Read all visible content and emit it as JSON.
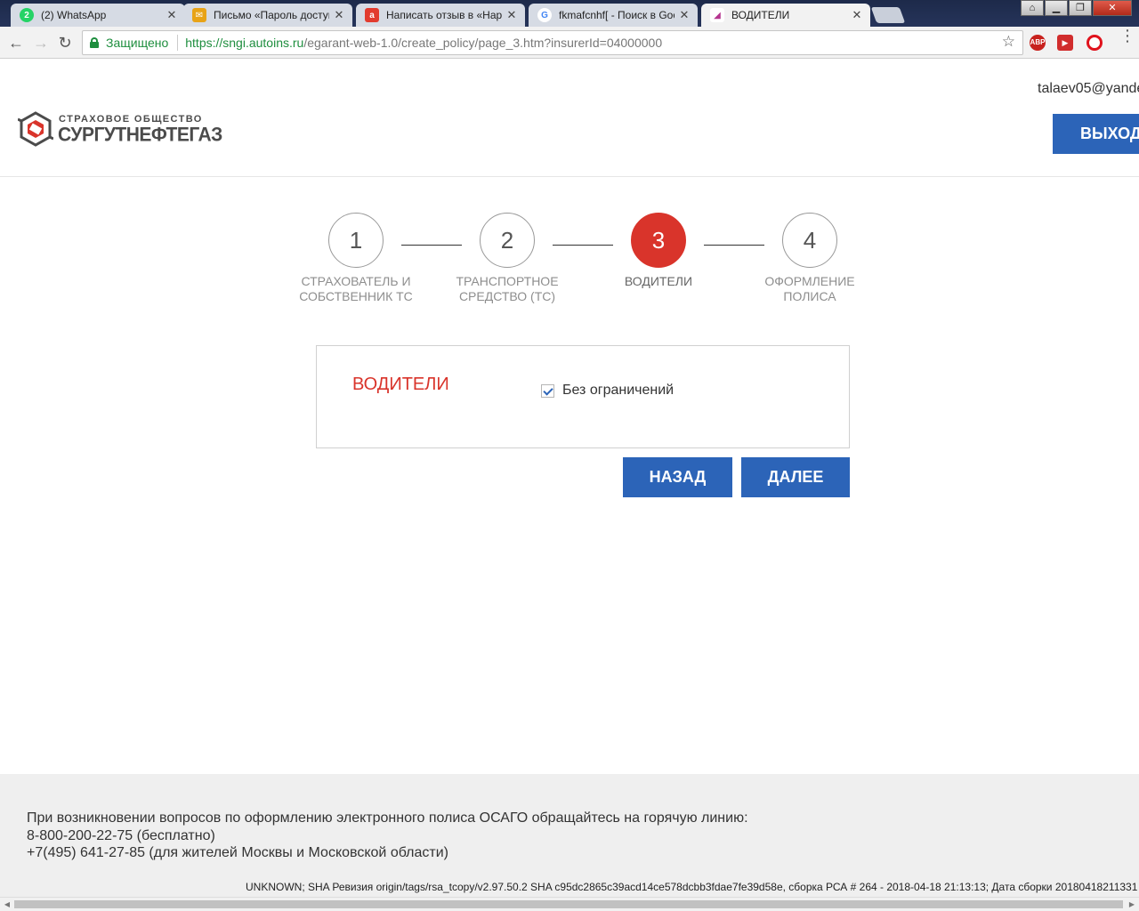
{
  "browser": {
    "tabs": [
      {
        "title": "(2) WhatsApp",
        "favicon_color": "#25d366",
        "favicon_text": "2"
      },
      {
        "title": "Письмо «Пароль доступа",
        "favicon_color": "#e8a317",
        "favicon_text": "✉"
      },
      {
        "title": "Написать отзыв в «Нарс",
        "favicon_color": "#e23b2e",
        "favicon_text": "a"
      },
      {
        "title": "fkmafcnhf[ - Поиск в Goo",
        "favicon_color": "#4285f4",
        "favicon_text": "G"
      },
      {
        "title": "ВОДИТЕЛИ",
        "favicon_color": "#b5348f",
        "favicon_text": "◢"
      }
    ],
    "secure_label": "Защищено",
    "url_host": "https://sngi.autoins.ru",
    "url_path": "/egarant-web-1.0/create_policy/page_3.htm?insurerId=04000000",
    "extensions": [
      "ABP",
      "▶",
      "O"
    ],
    "icons": [
      "back-icon",
      "forward-icon",
      "reload-icon",
      "lock-icon",
      "star-icon",
      "menu-icon"
    ]
  },
  "header": {
    "logo_line1": "СТРАХОВОЕ ОБЩЕСТВО",
    "logo_line2": "СУРГУТНЕФТЕГАЗ",
    "user_email": "talaev05@yande",
    "logout_label": "ВЫХОД"
  },
  "stepper": {
    "steps": [
      {
        "number": "1",
        "label": "СТРАХОВАТЕЛЬ И СОБСТВЕННИК ТС",
        "active": false
      },
      {
        "number": "2",
        "label": "ТРАНСПОРТНОЕ СРЕДСТВО (ТС)",
        "active": false
      },
      {
        "number": "3",
        "label": "ВОДИТЕЛИ",
        "active": true
      },
      {
        "number": "4",
        "label": "ОФОРМЛЕНИЕ ПОЛИСА",
        "active": false
      }
    ]
  },
  "drivers": {
    "title": "ВОДИТЕЛИ",
    "unlimited_label": "Без ограничений",
    "unlimited_checked": true
  },
  "actions": {
    "back_label": "НАЗАД",
    "next_label": "ДАЛЕЕ"
  },
  "footer": {
    "hotline_text": "При возникновении вопросов по оформлению электронного полиса ОСАГО обращайтесь на горячую линию:",
    "phone_free": "8-800-200-22-75 (бесплатно)",
    "phone_moscow": "+7(495) 641-27-85 (для жителей Москвы и Московской области)",
    "build_info": "UNKNOWN; SHA Ревизия origin/tags/rsa_tcopy/v2.97.50.2 SHA c95dc2865c39acd14ce578dcbb3fdae7fe39d58e, сборка РСА # 264 - 2018-04-18 21:13:13; Дата сборки 20180418211331"
  },
  "colors": {
    "accent_blue": "#2c64b8",
    "accent_red": "#d9342b",
    "secure_green": "#1e8e3e"
  }
}
